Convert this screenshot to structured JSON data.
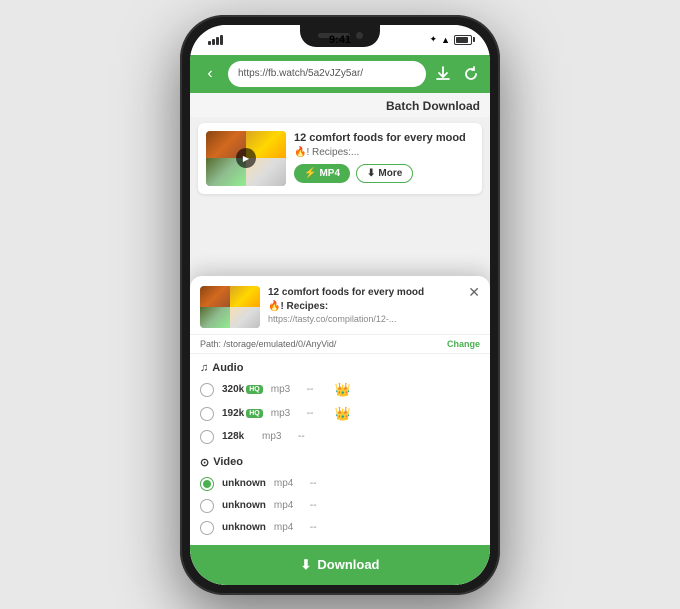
{
  "status": {
    "time": "9:41",
    "signal": "●●●",
    "battery": "full",
    "bluetooth": "⌗",
    "wifi": "▲"
  },
  "browser": {
    "url": "https://fb.watch/5a2vJZy5ar/",
    "back_icon": "‹",
    "download_icon": "⬇",
    "refresh_icon": "↺"
  },
  "batch_download": {
    "label": "Batch Download"
  },
  "video_card": {
    "title": "12 comfort foods for every mood",
    "subtitle": "🔥! Recipes:...",
    "btn_mp4": "MP4",
    "btn_more": "More",
    "btn_mp4_icon": "⚡",
    "btn_more_icon": "⬇"
  },
  "modal": {
    "close_icon": "✕",
    "title": "12 comfort foods for every mood",
    "subtitle": "🔥! Recipes:",
    "url": "https://tasty.co/compilation/12-...",
    "path_label": "Path: /storage/emulated/0/AnyVid/",
    "change_label": "Change",
    "audio_section": "Audio",
    "audio_icon": "♫",
    "video_section": "Video",
    "video_icon": "⊙",
    "audio_options": [
      {
        "quality": "320k",
        "hq": true,
        "format": "mp3",
        "size": "--",
        "crown": true
      },
      {
        "quality": "192k",
        "hq": true,
        "format": "mp3",
        "size": "--",
        "crown": true
      },
      {
        "quality": "128k",
        "hq": false,
        "format": "mp3",
        "size": "--",
        "crown": false
      }
    ],
    "video_options": [
      {
        "quality": "unknown",
        "format": "mp4",
        "size": "--",
        "selected": true
      },
      {
        "quality": "unknown",
        "format": "mp4",
        "size": "--",
        "selected": false
      },
      {
        "quality": "unknown",
        "format": "mp4",
        "size": "--",
        "selected": false
      }
    ],
    "download_label": "Download",
    "download_icon": "⬇"
  },
  "colors": {
    "green": "#4caf50",
    "crown_gold": "#FFA500"
  }
}
